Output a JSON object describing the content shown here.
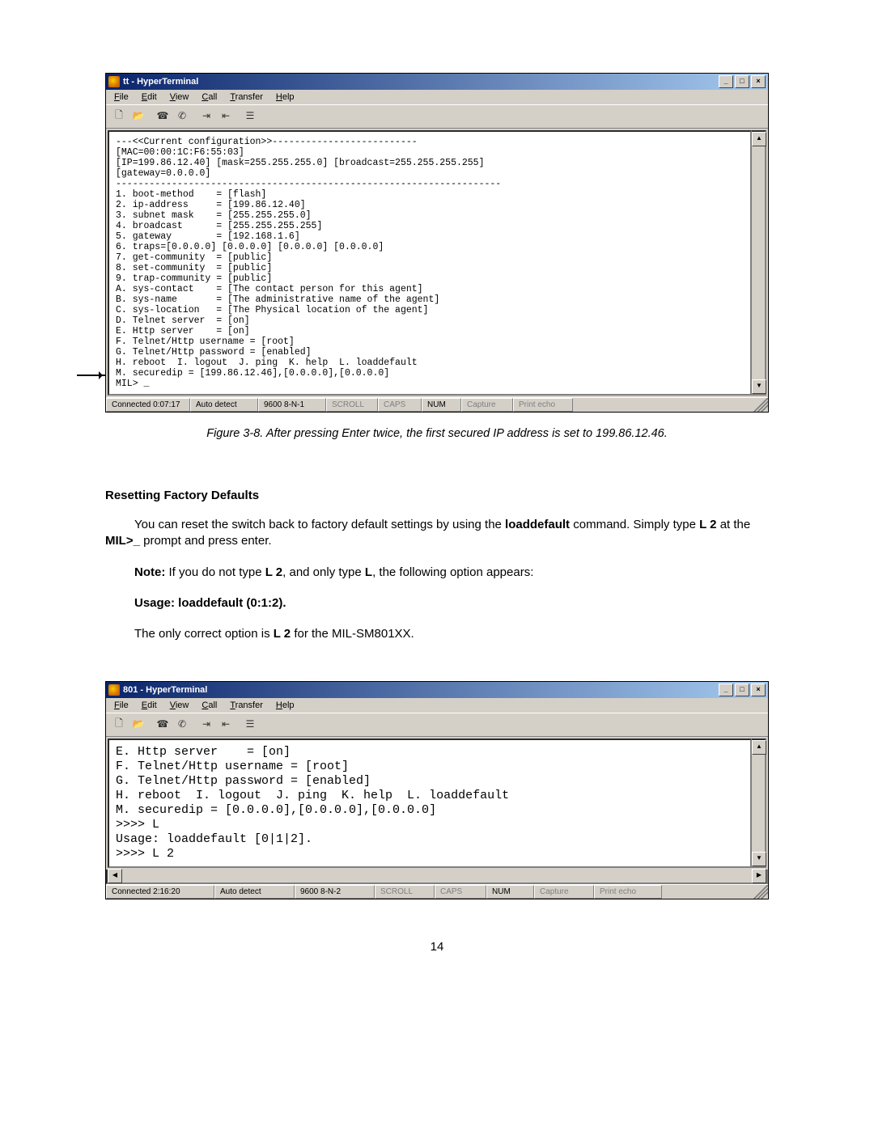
{
  "page_number": "14",
  "figure1": {
    "window_title": "tt - HyperTerminal",
    "menus": [
      "File",
      "Edit",
      "View",
      "Call",
      "Transfer",
      "Help"
    ],
    "toolbar_icons": [
      "new-doc-icon",
      "open-icon",
      "connect-icon",
      "disconnect-icon",
      "send-icon",
      "receive-icon",
      "properties-icon"
    ],
    "terminal_text": "---<<Current configuration>>--------------------------\n[MAC=00:00:1C:F6:55:03]\n[IP=199.86.12.40] [mask=255.255.255.0] [broadcast=255.255.255.255]\n[gateway=0.0.0.0]\n---------------------------------------------------------------------\n1. boot-method    = [flash]\n2. ip-address     = [199.86.12.40]\n3. subnet mask    = [255.255.255.0]\n4. broadcast      = [255.255.255.255]\n5. gateway        = [192.168.1.6]\n6. traps=[0.0.0.0] [0.0.0.0] [0.0.0.0] [0.0.0.0]\n7. get-community  = [public]\n8. set-community  = [public]\n9. trap-community = [public]\nA. sys-contact    = [The contact person for this agent]\nB. sys-name       = [The administrative name of the agent]\nC. sys-location   = [The Physical location of the agent]\nD. Telnet server  = [on]\nE. Http server    = [on]\nF. Telnet/Http username = [root]\nG. Telnet/Http password = [enabled]\nH. reboot  I. logout  J. ping  K. help  L. loaddefault\nM. securedip = [199.86.12.46],[0.0.0.0],[0.0.0.0]\nMIL> _",
    "status": {
      "connected": "Connected 0:07:17",
      "autodetect": "Auto detect",
      "baud": "9600 8-N-1",
      "scroll": "SCROLL",
      "caps": "CAPS",
      "num": "NUM",
      "capture": "Capture",
      "printecho": "Print echo"
    },
    "caption": "Figure 3-8. After pressing Enter twice, the first secured IP address is set to 199.86.12.46."
  },
  "section": {
    "heading": "Resetting Factory Defaults",
    "para1_a": "You can reset the switch back to factory default settings by using the ",
    "para1_b": "loaddefault",
    "para1_c": " command. Simply type ",
    "para1_d": "L 2",
    "para1_e": " at the ",
    "para1_f": "MIL>_",
    "para1_g": " prompt and press enter.",
    "para2_a": "Note:",
    "para2_b": " If you do not type ",
    "para2_c": "L 2",
    "para2_d": ", and only type ",
    "para2_e": "L",
    "para2_f": ",  the following option appears:",
    "usage": "Usage: loaddefault (0:1:2).",
    "para3_a": "The only correct option is ",
    "para3_b": "L 2",
    "para3_c": " for the MIL-SM801XX."
  },
  "figure2": {
    "window_title": "801 - HyperTerminal",
    "menus": [
      "File",
      "Edit",
      "View",
      "Call",
      "Transfer",
      "Help"
    ],
    "toolbar_icons": [
      "new-doc-icon",
      "open-icon",
      "connect-icon",
      "disconnect-icon",
      "send-icon",
      "receive-icon",
      "properties-icon"
    ],
    "terminal_text": "E. Http server    = [on]\nF. Telnet/Http username = [root]\nG. Telnet/Http password = [enabled]\nH. reboot  I. logout  J. ping  K. help  L. loaddefault\nM. securedip = [0.0.0.0],[0.0.0.0],[0.0.0.0]\n>>>> L\nUsage: loaddefault [0|1|2].\n>>>> L 2",
    "status": {
      "connected": "Connected 2:16:20",
      "autodetect": "Auto detect",
      "baud": "9600 8-N-2",
      "scroll": "SCROLL",
      "caps": "CAPS",
      "num": "NUM",
      "capture": "Capture",
      "printecho": "Print echo"
    }
  }
}
